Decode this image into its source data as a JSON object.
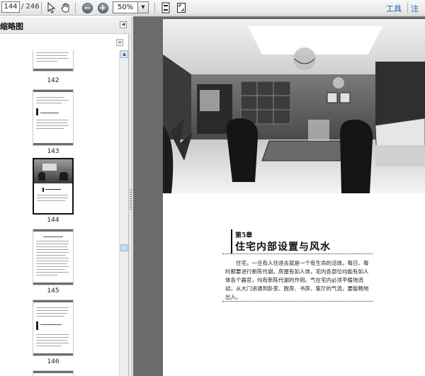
{
  "toolbar": {
    "current_page": "144",
    "page_total": "/ 246",
    "zoom_value": "50%",
    "tools_label": "工具",
    "comment_label": "注释"
  },
  "sidebar": {
    "title": "缩略图",
    "thumbnails": [
      {
        "label": "142"
      },
      {
        "label": "143"
      },
      {
        "label": "144"
      },
      {
        "label": "145"
      },
      {
        "label": "146"
      }
    ]
  },
  "document": {
    "chapter_number": "第5章",
    "chapter_title": "住宅内部设置与风水",
    "paragraph": "住宅，一旦有人住进去就是一个有生命的活体。每日、每时都要进行新陈代谢。房屋有如人体，宅内各部位均能有如人体各个器官，均有新陈代谢的作用。气在宅内必须平缓地流动，从大门进通到卧室、厨房、书房、客厅的气流，要能畅地出入。"
  }
}
